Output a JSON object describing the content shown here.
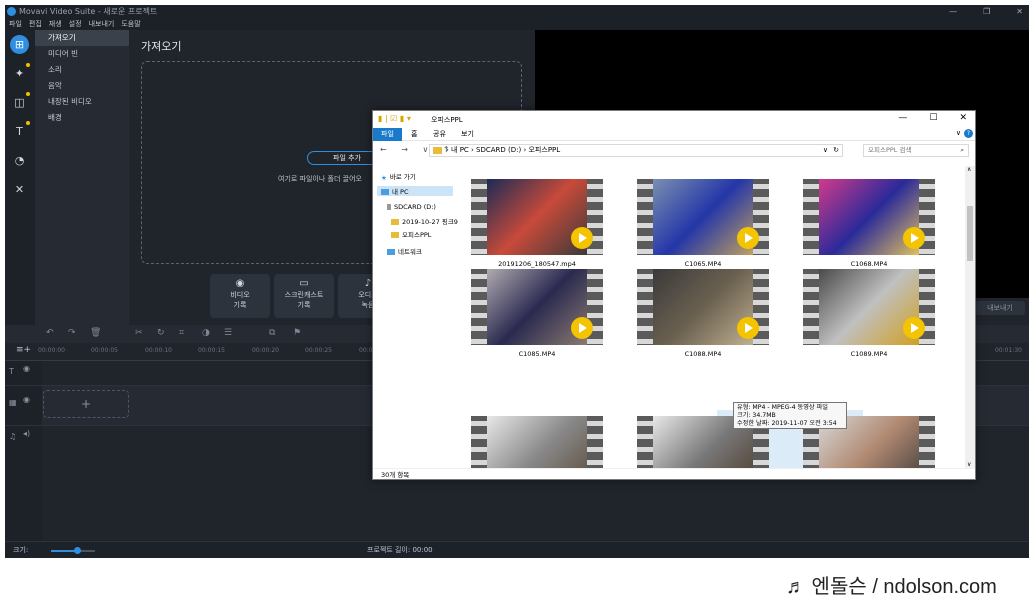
{
  "app": {
    "title": "Movavi Video Suite - 새로운 프로젝트",
    "window_buttons": [
      "—",
      "❐",
      "✕"
    ],
    "menu": [
      "파일",
      "편집",
      "재생",
      "설정",
      "내보내기",
      "도움말"
    ],
    "left_icons": [
      "import-icon",
      "magic-wand-icon",
      "transition-icon",
      "title-icon",
      "filter-icon",
      "tools-icon"
    ],
    "sub_items": [
      "가져오기",
      "미디어 빈",
      "소리",
      "음악",
      "내장된 비디오",
      "배경"
    ],
    "import": {
      "title": "가져오기",
      "add_files": "파일 추가",
      "drop_hint": "여기로 파일이나 폴더 끌어오",
      "tiles": [
        {
          "label": "비디오\n기록",
          "icon": "webcam-icon"
        },
        {
          "label": "스크린캐스트\n기록",
          "icon": "monitor-icon"
        },
        {
          "label": "오디오\n녹음",
          "icon": "mic-icon"
        }
      ]
    },
    "export_label": "내보내기",
    "ruler_ticks": [
      "00:00:00",
      "00:00:05",
      "00:00:10",
      "00:00:15",
      "00:00:20",
      "00:00:25",
      "00:00:30"
    ],
    "ruler_end": "00:01:30",
    "add_track": "+",
    "scale_label": "크기:",
    "project_length": "프로젝트 길이: 00:00",
    "zoom_fraction": 0.6
  },
  "explorer": {
    "title": "오피스PPL",
    "window_buttons": [
      "—",
      "☐",
      "✕"
    ],
    "ribbon_tabs": [
      "파일",
      "홈",
      "공유",
      "보기"
    ],
    "nav_buttons": "← → ∨ ↑",
    "address": "› 내 PC › SDCARD (D:) › 오피스PPL",
    "search_placeholder": "오피스PPL 검색",
    "nav_items": [
      "바로 가기",
      "내 PC",
      "SDCARD (D:)",
      "2019-10-27 핑크9",
      "오피스PPL",
      "네트워크"
    ],
    "files": [
      "20191206_180547.mp4",
      "C1065.MP4",
      "C1068.MP4",
      "C1085.MP4",
      "C1088.MP4",
      "C1089.MP4",
      "",
      "",
      ""
    ],
    "tooltip": [
      "유형: MP4 - MPEG-4 동영상 파일",
      "크기: 34.7MB",
      "수정한 날짜: 2019-11-07 오전 3:54"
    ],
    "status": "30개 항목"
  },
  "credit": "♬ 엔돌슨 / ndolson.com",
  "colors": {
    "accent": "#2f8ee0",
    "app_bg": "#20242b",
    "play": "#f5c400",
    "explorer_tab": "#1979ca"
  }
}
